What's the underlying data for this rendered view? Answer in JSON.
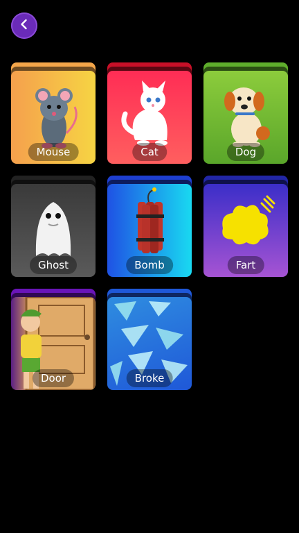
{
  "header": {
    "back_icon": "chevron-left-icon"
  },
  "cards": [
    {
      "label": "Mouse",
      "tab_color": "#f4a64a",
      "bg_from": "#f5a04d",
      "bg_to": "#f6d443",
      "icon": "mouse-icon"
    },
    {
      "label": "Cat",
      "tab_color": "#c81028",
      "bg_from": "#ff2d55",
      "bg_to": "#ff5f5f",
      "icon": "cat-icon"
    },
    {
      "label": "Dog",
      "tab_color": "#5fae2c",
      "bg_from": "#8ccc3c",
      "bg_to": "#5aa62a",
      "icon": "dog-icon"
    },
    {
      "label": "Ghost",
      "tab_color": "#222222",
      "bg_from": "#3a3a3a",
      "bg_to": "#5a5a5a",
      "icon": "ghost-icon"
    },
    {
      "label": "Bomb",
      "tab_color": "#1e3fd0",
      "bg_from": "#1f52e4",
      "bg_to": "#19d9f1",
      "icon": "dynamite-icon"
    },
    {
      "label": "Fart",
      "tab_color": "#2226a6",
      "bg_from": "#3b2ec8",
      "bg_to": "#a654d3",
      "icon": "fart-cloud-icon"
    },
    {
      "label": "Door",
      "tab_color": "#6a15b8",
      "bg_from": "#d69a56",
      "bg_to": "#e2b06e",
      "icon": "door-icon"
    },
    {
      "label": "Broke",
      "tab_color": "#1f58d8",
      "bg_from": "#2f8de0",
      "bg_to": "#1f58d8",
      "icon": "broken-glass-icon"
    }
  ]
}
